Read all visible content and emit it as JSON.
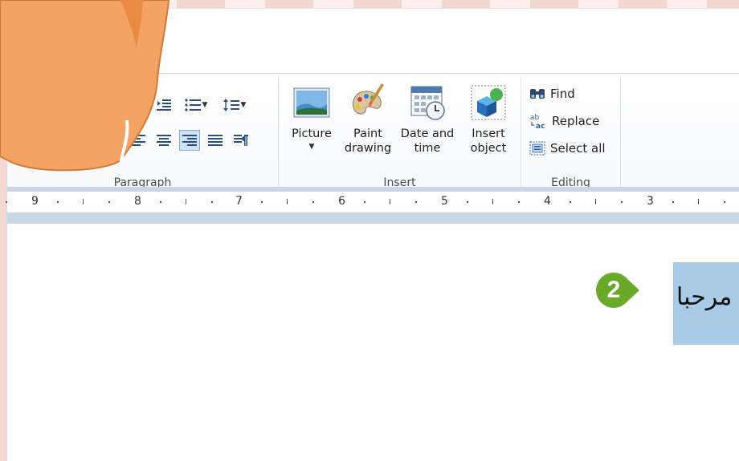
{
  "ribbon": {
    "paragraph": {
      "label": "Paragraph"
    },
    "insert": {
      "label": "Insert",
      "buttons": [
        {
          "label": "Picture",
          "icon": "picture-icon",
          "has_dropdown": true
        },
        {
          "label": "Paint\ndrawing",
          "icon": "paint-palette-icon"
        },
        {
          "label": "Date and\ntime",
          "icon": "calendar-clock-icon"
        },
        {
          "label": "Insert\nobject",
          "icon": "object-cube-icon"
        }
      ]
    },
    "editing": {
      "label": "Editing",
      "items": [
        {
          "label": "Find",
          "icon": "binoculars-icon"
        },
        {
          "label": "Replace",
          "icon": "replace-icon"
        },
        {
          "label": "Select all",
          "icon": "select-all-icon"
        }
      ]
    }
  },
  "ruler": {
    "numbers": [
      "9",
      "8",
      "7",
      "6",
      "5",
      "4",
      "3"
    ]
  },
  "document": {
    "selected_text": "مرحبا"
  },
  "annotation": {
    "step_number": "2",
    "color": "#6aa829"
  },
  "colors": {
    "selection": "#a8cbe8",
    "hand": "#f3a363",
    "ruler_bar": "#c8d6e6"
  }
}
